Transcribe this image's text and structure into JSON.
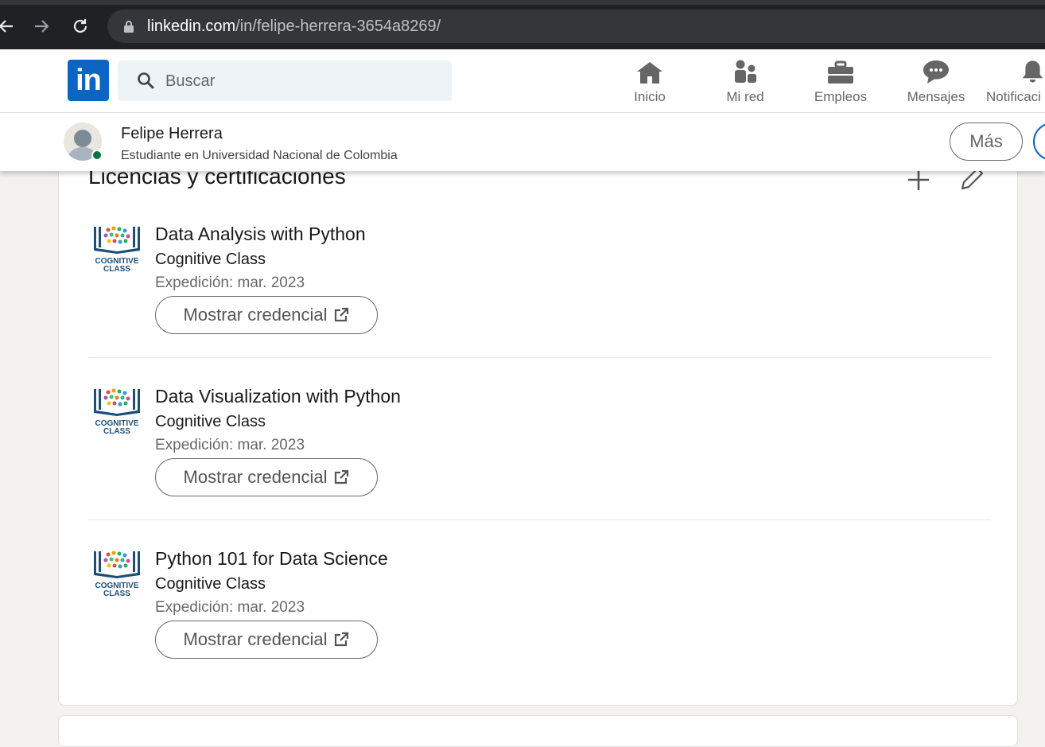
{
  "browser": {
    "url_host": "linkedin.com",
    "url_path": "/in/felipe-herrera-3654a8269/"
  },
  "header": {
    "logo_text": "in",
    "search_placeholder": "Buscar",
    "nav": [
      {
        "label": "Inicio",
        "icon": "home-icon"
      },
      {
        "label": "Mi red",
        "icon": "network-icon"
      },
      {
        "label": "Empleos",
        "icon": "briefcase-icon"
      },
      {
        "label": "Mensajes",
        "icon": "messaging-icon"
      },
      {
        "label": "Notificaci",
        "icon": "bell-icon"
      }
    ],
    "brand_color": "#0a66c2"
  },
  "sticky_profile": {
    "name": "Felipe Herrera",
    "headline": "Estudiante en Universidad Nacional de Colombia",
    "more_label": "Más",
    "online_color": "#057642"
  },
  "certifications": {
    "title": "Licencias y certificaciones",
    "logo_text_line1": "COGNITIVE",
    "logo_text_line2": "CLASS",
    "items": [
      {
        "title": "Data Analysis with Python",
        "issuer": "Cognitive Class",
        "date": "Expedición: mar. 2023",
        "button": "Mostrar credencial"
      },
      {
        "title": "Data Visualization with Python",
        "issuer": "Cognitive Class",
        "date": "Expedición: mar. 2023",
        "button": "Mostrar credencial"
      },
      {
        "title": "Python 101 for Data Science",
        "issuer": "Cognitive Class",
        "date": "Expedición: mar. 2023",
        "button": "Mostrar credencial"
      }
    ]
  }
}
